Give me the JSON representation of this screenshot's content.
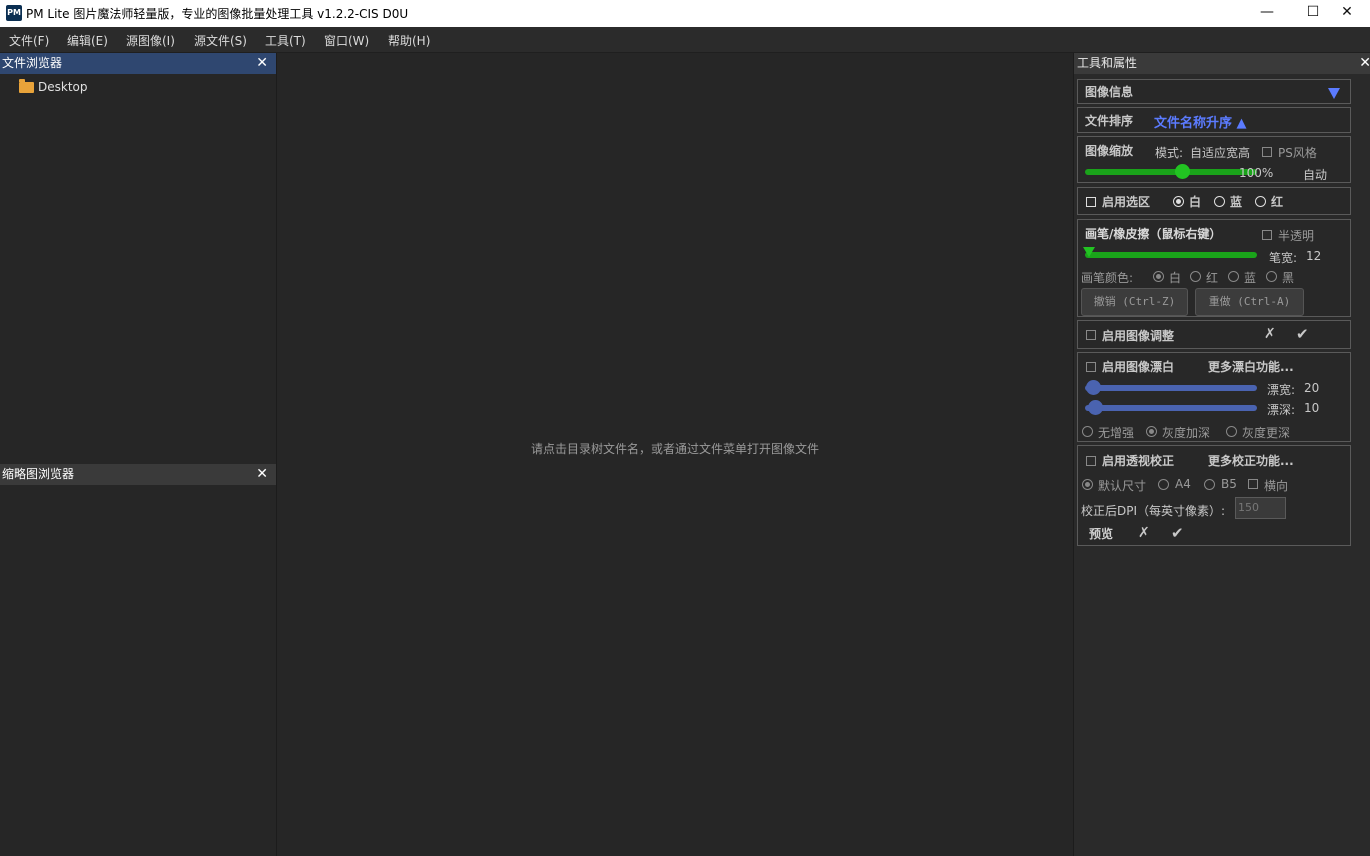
{
  "window": {
    "title": "PM Lite 图片魔法师轻量版，专业的图像批量处理工具 v1.2.2-CIS D0U",
    "app_icon": "PM",
    "minimize": "—",
    "maximize": "☐",
    "close": "✕"
  },
  "menu": [
    "文件(F)",
    "编辑(E)",
    "源图像(I)",
    "源文件(S)",
    "工具(T)",
    "窗口(W)",
    "帮助(H)"
  ],
  "file_browser": {
    "title": "文件浏览器",
    "close": "✕",
    "items": [
      {
        "label": "Desktop",
        "icon": "folder-icon"
      }
    ]
  },
  "thumb_browser": {
    "title": "缩略图浏览器",
    "close": "✕"
  },
  "center": {
    "hint": "请点击目录树文件名，或者通过文件菜单打开图像文件"
  },
  "tools": {
    "title": "工具和属性",
    "close": "✕",
    "image_info": {
      "label": "图像信息",
      "icon": "triangle-down-icon"
    },
    "sort": {
      "label": "文件排序",
      "value": "文件名称升序 ▲"
    },
    "zoom": {
      "label": "图像缩放",
      "mode_label": "模式:",
      "mode_value": "自适应宽高",
      "ps_style": "PS风格",
      "percent": "100%",
      "auto": "自动",
      "level": 0.58
    },
    "selection": {
      "enable": "启用选区",
      "options": [
        "白",
        "蓝",
        "红"
      ],
      "selected": "白"
    },
    "brush": {
      "label": "画笔/橡皮擦（鼠标右键）",
      "semi_transparent": "半透明",
      "width_label": "笔宽:",
      "width_value": "12",
      "color_label": "画笔颜色:",
      "colors": [
        "白",
        "红",
        "蓝",
        "黑"
      ],
      "undo": "撤销 (Ctrl-Z)",
      "redo": "重做 (Ctrl-A)"
    },
    "adjust": {
      "enable": "启用图像调整",
      "cancel": "✗",
      "ok": "✔"
    },
    "whiten": {
      "enable": "启用图像漂白",
      "more": "更多漂白功能...",
      "width_label": "漂宽:",
      "width_value": "20",
      "depth_label": "漂深:",
      "depth_value": "10",
      "modes": [
        "无增强",
        "灰度加深",
        "灰度更深"
      ],
      "selected_mode": "灰度加深"
    },
    "perspective": {
      "enable": "启用透视校正",
      "more": "更多校正功能...",
      "sizes": [
        "默认尺寸",
        "A4",
        "B5"
      ],
      "landscape": "横向",
      "dpi_label": "校正后DPI（每英寸像素）:",
      "dpi_value": "150",
      "preview": "预览",
      "cancel": "✗",
      "ok": "✔"
    }
  },
  "colors": {
    "green": "#1aa31a",
    "blue_slider": "#4a63b0",
    "accent": "#5b7bff",
    "dock_title": "#2f4770"
  }
}
